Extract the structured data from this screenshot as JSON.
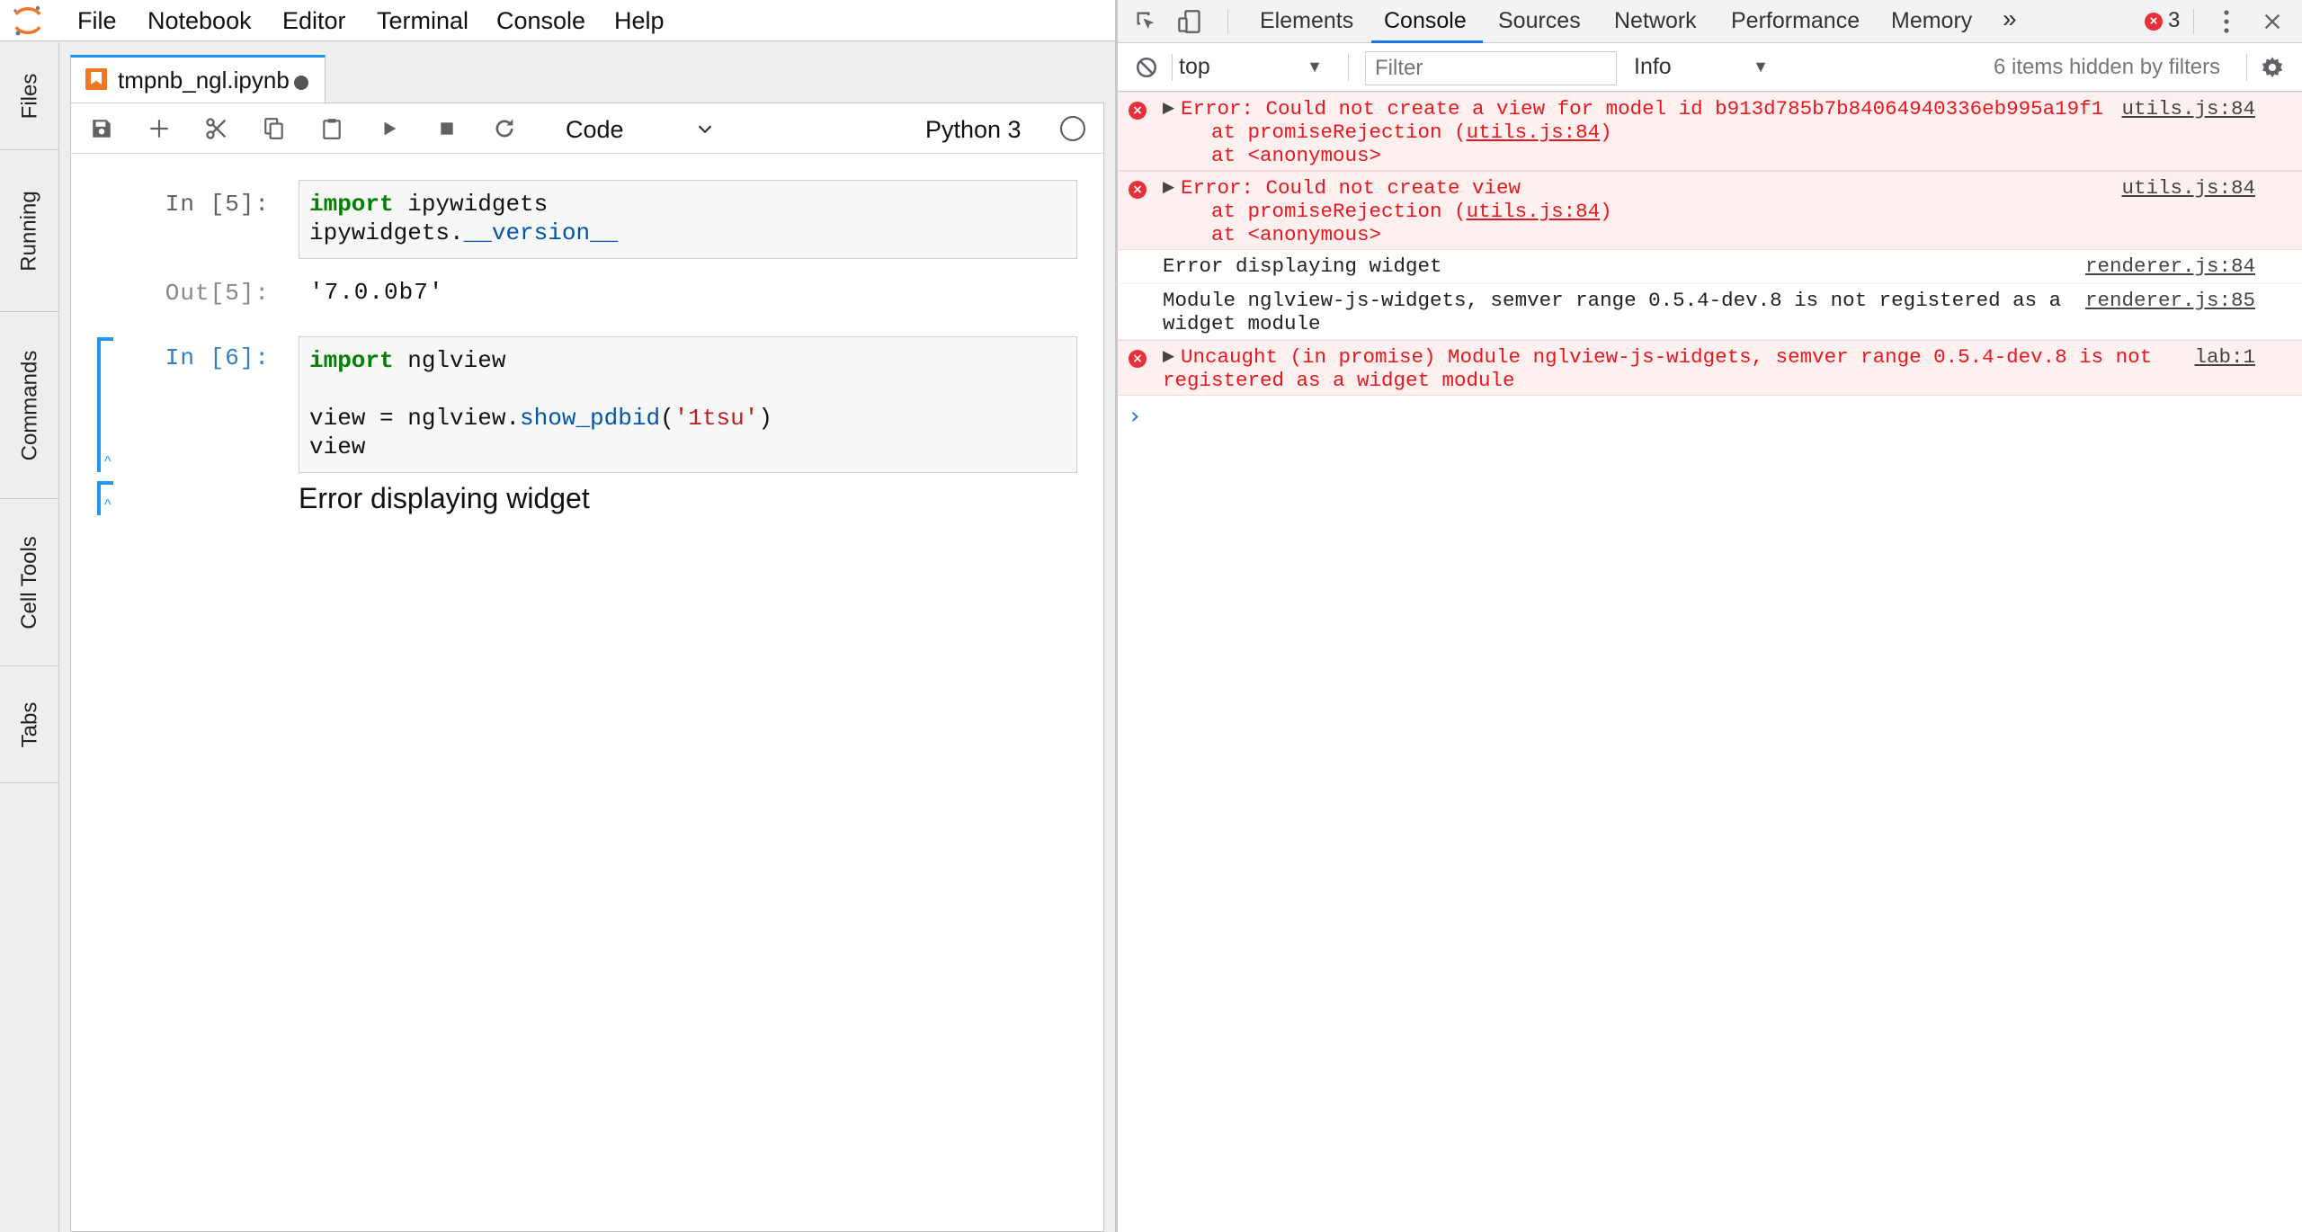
{
  "menubar": {
    "items": [
      "File",
      "Notebook",
      "Editor",
      "Terminal",
      "Console",
      "Help"
    ]
  },
  "sidebar": {
    "tabs": [
      "Files",
      "Running",
      "Commands",
      "Cell Tools",
      "Tabs"
    ]
  },
  "document_tab": {
    "label": "tmpnb_ngl.ipynb"
  },
  "toolbar": {
    "cell_type": "Code",
    "kernel_name": "Python 3"
  },
  "cells": [
    {
      "prompt_in": "In [5]:",
      "code_lines": [
        [
          {
            "t": "import",
            "c": "kw"
          },
          {
            "t": " ipywidgets",
            "c": ""
          }
        ],
        [
          {
            "t": "ipywidgets.",
            "c": ""
          },
          {
            "t": "__version__",
            "c": "attr"
          }
        ]
      ],
      "prompt_out": "Out[5]:",
      "output": "'7.0.0b7'"
    },
    {
      "prompt_in": "In [6]:",
      "code_lines": [
        [
          {
            "t": "import",
            "c": "kw"
          },
          {
            "t": " nglview",
            "c": ""
          }
        ],
        [
          {
            "t": "",
            "c": ""
          }
        ],
        [
          {
            "t": "view = nglview.",
            "c": ""
          },
          {
            "t": "show_pdbid",
            "c": "attr"
          },
          {
            "t": "(",
            "c": ""
          },
          {
            "t": "'1tsu'",
            "c": "str"
          },
          {
            "t": ")",
            "c": ""
          }
        ],
        [
          {
            "t": "view",
            "c": ""
          }
        ]
      ],
      "output": "Error displaying widget"
    }
  ],
  "devtools": {
    "tabs": [
      "Elements",
      "Console",
      "Sources",
      "Network",
      "Performance",
      "Memory"
    ],
    "active_tab": "Console",
    "error_count": "3",
    "context": "top",
    "filter_placeholder": "Filter",
    "level": "Info",
    "hidden_note": "6 items hidden by filters",
    "console_messages": [
      {
        "level": "error",
        "expandable": true,
        "lines": [
          "Error: Could not create a view for model id b913d785b7b84064940336eb995a19f1",
          "    at promiseRejection (utils.js:84)",
          "    at <anonymous>"
        ],
        "source": "utils.js:84"
      },
      {
        "level": "error",
        "expandable": true,
        "lines": [
          "Error: Could not create view",
          "    at promiseRejection (utils.js:84)",
          "    at <anonymous>"
        ],
        "source": "utils.js:84"
      },
      {
        "level": "info",
        "expandable": false,
        "lines": [
          "Error displaying widget"
        ],
        "source": "renderer.js:84"
      },
      {
        "level": "info",
        "expandable": false,
        "lines": [
          "Module nglview-js-widgets, semver range 0.5.4-dev.8 is not registered as a",
          "widget module"
        ],
        "source": "renderer.js:85"
      },
      {
        "level": "error",
        "expandable": true,
        "lines": [
          "Uncaught (in promise) Module nglview-js-widgets, semver range 0.5.4-dev.8 is not",
          "registered as a widget module"
        ],
        "source": "lab:1"
      }
    ]
  },
  "colors": {
    "accent": "#2196f3",
    "jupyter_orange": "#f37626",
    "error_red": "#e8171e",
    "error_bg": "#fff0f0",
    "keyword_green": "#008000",
    "string_red": "#ba2121"
  }
}
